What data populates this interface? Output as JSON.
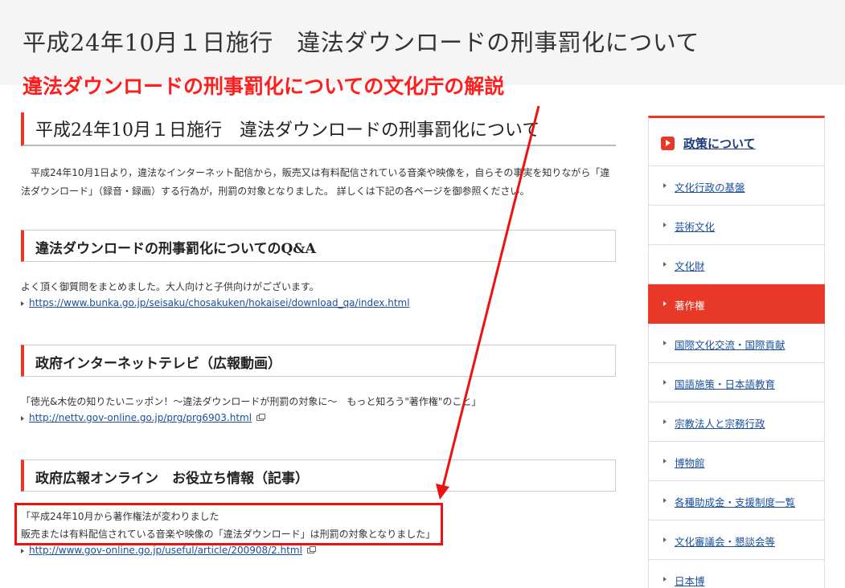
{
  "header": {
    "title": "平成24年10月１日施行　違法ダウンロードの刑事罰化について"
  },
  "annotation": {
    "caption": "違法ダウンロードの刑事罰化についての文化庁の解説",
    "color": "#ff1e1e"
  },
  "article": {
    "title": "平成24年10月１日施行　違法ダウンロードの刑事罰化について",
    "intro_line1": "平成24年10月1日より，違法なインターネット配信から，販売又は有料配信されている音楽や映像を，自らその事実を知りながら「違",
    "intro_line2": "法ダウンロード」（録音・録画）する行為が，刑罰の対象となりました。 詳しくは下記の各ページを御参照ください。",
    "sections": [
      {
        "heading": "違法ダウンロードの刑事罰化についてのQ&A",
        "desc": "よく頂く御質問をまとめました。大人向けと子供向けがございます。",
        "link": "https://www.bunka.go.jp/seisaku/chosakuken/hokaisei/download_qa/index.html"
      },
      {
        "heading": "政府インターネットテレビ（広報動画）",
        "desc": "「徳光&木佐の知りたいニッポン！～違法ダウンロードが刑罰の対象に～　もっと知ろう\"著作権\"のこと」",
        "link": "http://nettv.gov-online.go.jp/prg/prg6903.html"
      },
      {
        "heading": "政府広報オンライン　お役立ち情報（記事）",
        "desc_line1": "「平成24年10月から著作権法が変わりました",
        "desc_line2": "販売または有料配信されている音楽や映像の「違法ダウンロード」は刑罰の対象となりました」",
        "link": "http://www.gov-online.go.jp/useful/article/200908/2.html"
      }
    ]
  },
  "sidebar": {
    "title": "政策について",
    "accent": "#e83828",
    "items": [
      {
        "label": "文化行政の基盤"
      },
      {
        "label": "芸術文化"
      },
      {
        "label": "文化財"
      },
      {
        "label": "著作権"
      },
      {
        "label": "国際文化交流・国際貢献"
      },
      {
        "label": "国語施策・日本語教育"
      },
      {
        "label": "宗教法人と宗務行政"
      },
      {
        "label": "博物館"
      },
      {
        "label": "各種助成金・支援制度一覧"
      },
      {
        "label": "文化審議会・懇談会等"
      },
      {
        "label": "日本博"
      }
    ],
    "active_item": "著作権"
  }
}
